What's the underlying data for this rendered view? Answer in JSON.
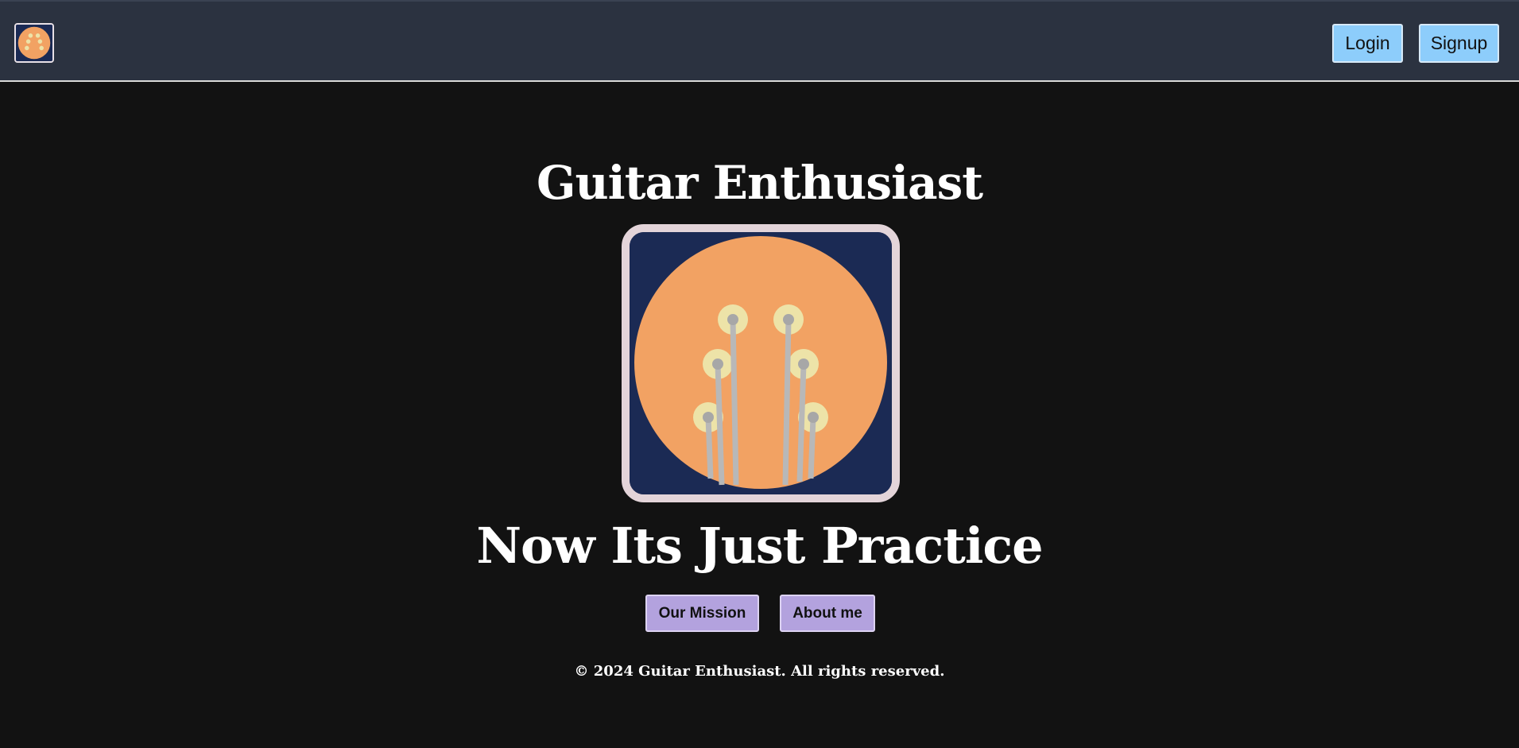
{
  "header": {
    "logo_icon": "guitar-headstock-logo-icon",
    "login_label": "Login",
    "signup_label": "Signup"
  },
  "hero": {
    "title": "Guitar Enthusiast",
    "image_icon": "guitar-headstock-illustration",
    "subtitle": "Now Its Just Practice"
  },
  "actions": {
    "mission_label": "Our Mission",
    "about_label": "About me"
  },
  "footer": {
    "copyright": "© 2024 Guitar Enthusiast. All rights reserved."
  },
  "colors": {
    "page_background": "#121212",
    "header_background": "#2b3240",
    "nav_button": "#8dcdfb",
    "cta_button": "#b3a2de",
    "logo_navy": "#1b2a54",
    "logo_orange": "#f2a263",
    "tuning_peg": "#ede3a8",
    "string": "#b8b8b8"
  }
}
